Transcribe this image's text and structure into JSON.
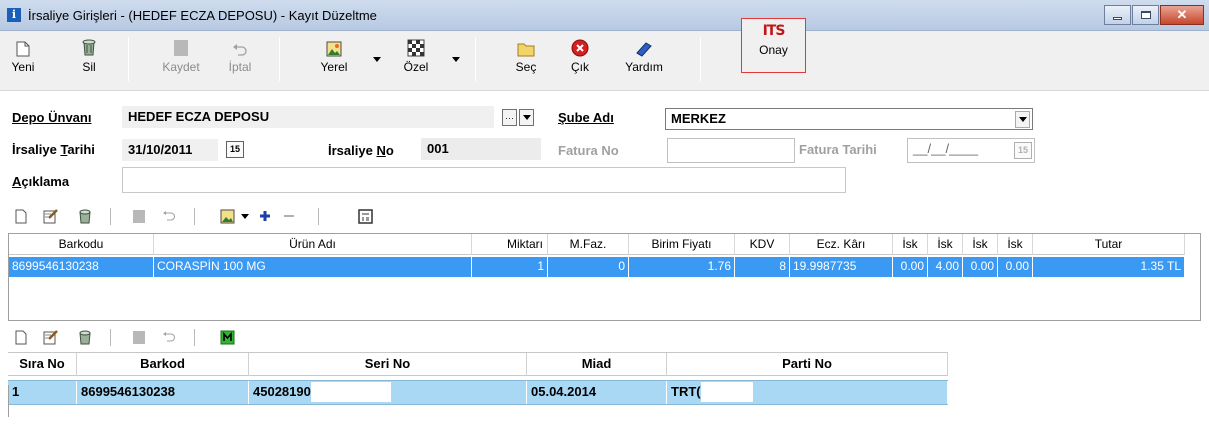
{
  "window": {
    "title": "İrsaliye Girişleri - (HEDEF ECZA DEPOSU) - Kayıt Düzeltme",
    "app_icon": "i"
  },
  "toolbar": {
    "new_label": "Yeni",
    "delete_label": "Sil",
    "save_label": "Kaydet",
    "cancel_label": "İptal",
    "local_label": "Yerel",
    "custom_label": "Özel",
    "select_label": "Seç",
    "exit_label": "Çık",
    "help_label": "Yardım",
    "its_mark": "ITS",
    "its_label": "Onay"
  },
  "form": {
    "depot_label": "Depo Ünvanı",
    "depot_value": "HEDEF ECZA DEPOSU",
    "branch_label": "Şube Adı",
    "branch_value": "MERKEZ",
    "waybill_date_label_a": "İrsaliye ",
    "waybill_date_label_b": "T",
    "waybill_date_label_c": "arihi",
    "waybill_date_value": "31/10/2011",
    "waybill_no_label_a": "İrsaliye ",
    "waybill_no_label_b": "N",
    "waybill_no_label_c": "o",
    "waybill_no_value": "001",
    "invoice_no_label": "Fatura No",
    "invoice_no_value": "",
    "invoice_date_label": "Fatura Tarihi",
    "invoice_date_value": "__/__/____",
    "description_label_a": "A",
    "description_label_b": "çıklama",
    "description_value": "",
    "calendar_glyph": "15"
  },
  "items_grid": {
    "columns": [
      "Barkodu",
      "Ürün Adı",
      "Miktarı",
      "M.Faz.",
      "Birim Fiyatı",
      "KDV",
      "Ecz. Kârı",
      "İsk",
      "İsk",
      "İsk",
      "İsk",
      "Tutar"
    ],
    "rows": [
      [
        "8699546130238",
        "CORASPİN 100 MG",
        "1",
        "0",
        "1.76",
        "8",
        "19.9987735",
        "0.00",
        "4.00",
        "0.00",
        "0.00",
        "1.35 TL"
      ]
    ]
  },
  "serial_grid": {
    "columns": [
      "Sıra No",
      "Barkod",
      "Seri No",
      "Miad",
      "Parti No"
    ],
    "rows": [
      [
        "1",
        "8699546130238",
        "45028190",
        "05.04.2014",
        "TRT("
      ]
    ]
  },
  "colors": {
    "selected_row": "#3a99f2",
    "serial_row": "#a8d8f4",
    "its_accent": "#c01818"
  }
}
